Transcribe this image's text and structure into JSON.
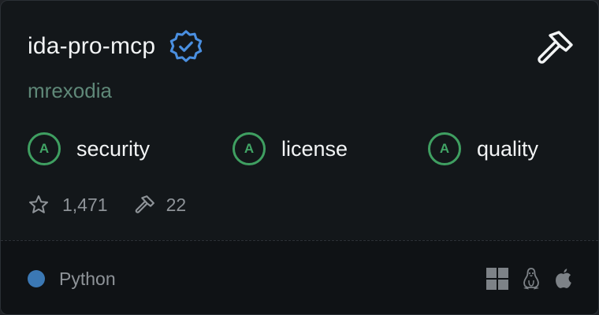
{
  "server": {
    "name": "ida-pro-mcp",
    "author": "mrexodia"
  },
  "grades": [
    {
      "letter": "A",
      "label": "security"
    },
    {
      "letter": "A",
      "label": "license"
    },
    {
      "letter": "A",
      "label": "quality"
    }
  ],
  "stats": {
    "stars": "1,471",
    "tools": "22"
  },
  "footer": {
    "language": "Python",
    "language_color": "#3b78b4",
    "platforms": [
      "windows-icon",
      "linux-icon",
      "apple-icon"
    ]
  },
  "colors": {
    "grade_accent": "#41a566",
    "verified_badge": "#4a8fe0"
  }
}
